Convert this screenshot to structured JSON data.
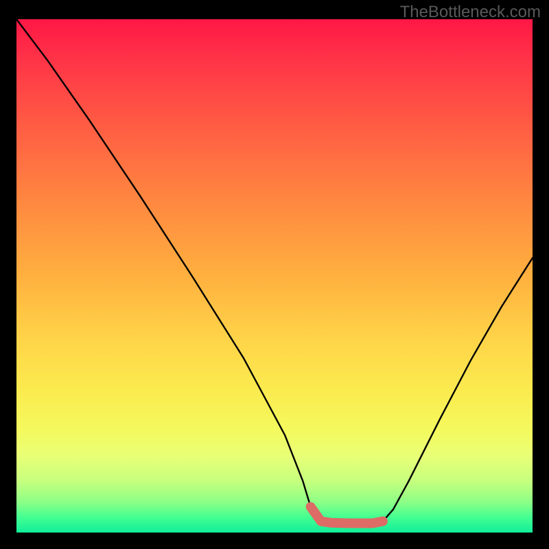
{
  "watermark": "TheBottleneck.com",
  "chart_data": {
    "type": "line",
    "title": "",
    "xlabel": "",
    "ylabel": "",
    "xlim": [
      0,
      100
    ],
    "ylim": [
      0,
      100
    ],
    "series": [
      {
        "name": "curve",
        "color": "#000000",
        "x": [
          0,
          6,
          14,
          24,
          34,
          44,
          52,
          55.5,
          57,
          59,
          61,
          65,
          69,
          71,
          73,
          76,
          82,
          88,
          94,
          100
        ],
        "y": [
          100,
          92,
          80.5,
          65.5,
          50,
          34,
          19,
          10,
          5,
          2.2,
          1.9,
          1.8,
          1.8,
          2.2,
          4.5,
          10,
          22,
          33.5,
          44,
          53.5
        ]
      },
      {
        "name": "flat-segment",
        "color": "#dd6b66",
        "x": [
          57,
          59,
          61,
          65,
          69,
          71
        ],
        "y": [
          5,
          2.2,
          1.9,
          1.8,
          1.8,
          2.2
        ]
      }
    ],
    "annotations": [],
    "legend": false,
    "grid": false
  },
  "colors": {
    "background": "#000000",
    "curve": "#000000",
    "flat_segment": "#dd6b66",
    "watermark": "#595959"
  }
}
